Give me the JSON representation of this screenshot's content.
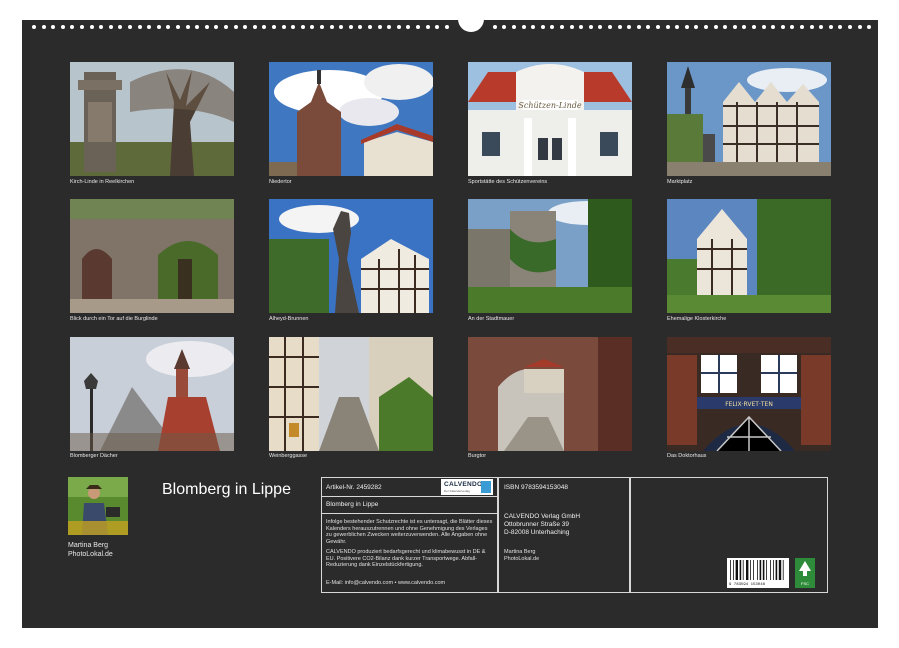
{
  "photos": [
    {
      "caption": "Kirch-Linde in Reelkirchen"
    },
    {
      "caption": "Niedertor"
    },
    {
      "caption": "Sportstätte des Schützenvereins"
    },
    {
      "caption": "Marktplatz"
    },
    {
      "caption": "Blick durch ein Tor auf die Burglinde"
    },
    {
      "caption": "Alheyd-Brunnen"
    },
    {
      "caption": "An der Stadtmauer"
    },
    {
      "caption": "Ehemalige Klosterkirche"
    },
    {
      "caption": "Blomberger Dächer"
    },
    {
      "caption": "Weinberggasse"
    },
    {
      "caption": "Burgtor"
    },
    {
      "caption": "Das Doktorhaus"
    }
  ],
  "sign_texts": {
    "sportstaette_sign": "Schützen-Linde",
    "doktorhaus_inscription": "FELIX·RVET·TEN"
  },
  "author": {
    "name": "Martina Berg",
    "site": "PhotoLokal.de"
  },
  "title": "Blomberg in Lippe",
  "info": {
    "article": "Artikel-Nr. 2459282",
    "product_title": "Blomberg in Lippe",
    "legal": "Infolge bestehender Schutzrechte ist es untersagt, die Blätter dieses Kalenders herauszutrennen und ohne Genehmigung des Verlages zu gewerblichen Zwecken weiterzuverwenden. Alle Angaben ohne Gewähr.",
    "eco": "CALVENDO produziert bedarfsgerecht und klimabewusst in DE & EU. Positivere CO2-Bilanz dank kurzer Transportwege. Abfall-Reduzierung dank Einzelstückfertigung.",
    "contact": "E-Mail: info@calvendo.com • www.calvendo.com",
    "isbn": "ISBN 9783594153048",
    "publisher_name": "CALVENDO Verlag GmbH",
    "publisher_street": "Ottobrunner Straße 39",
    "publisher_city": "D-82008 Unterhaching",
    "credit_name": "Martina Berg",
    "credit_site": "PhotoLokal.de",
    "barcode_number": "9 783594 153048",
    "logo_text": "CALVENDO",
    "logo_subtext": "Der Kalenderverlag",
    "fsc_label": "FSC"
  },
  "colors": {
    "background": "#2b2b2b",
    "text": "#e8e8e8",
    "border": "#d8d8d8"
  }
}
